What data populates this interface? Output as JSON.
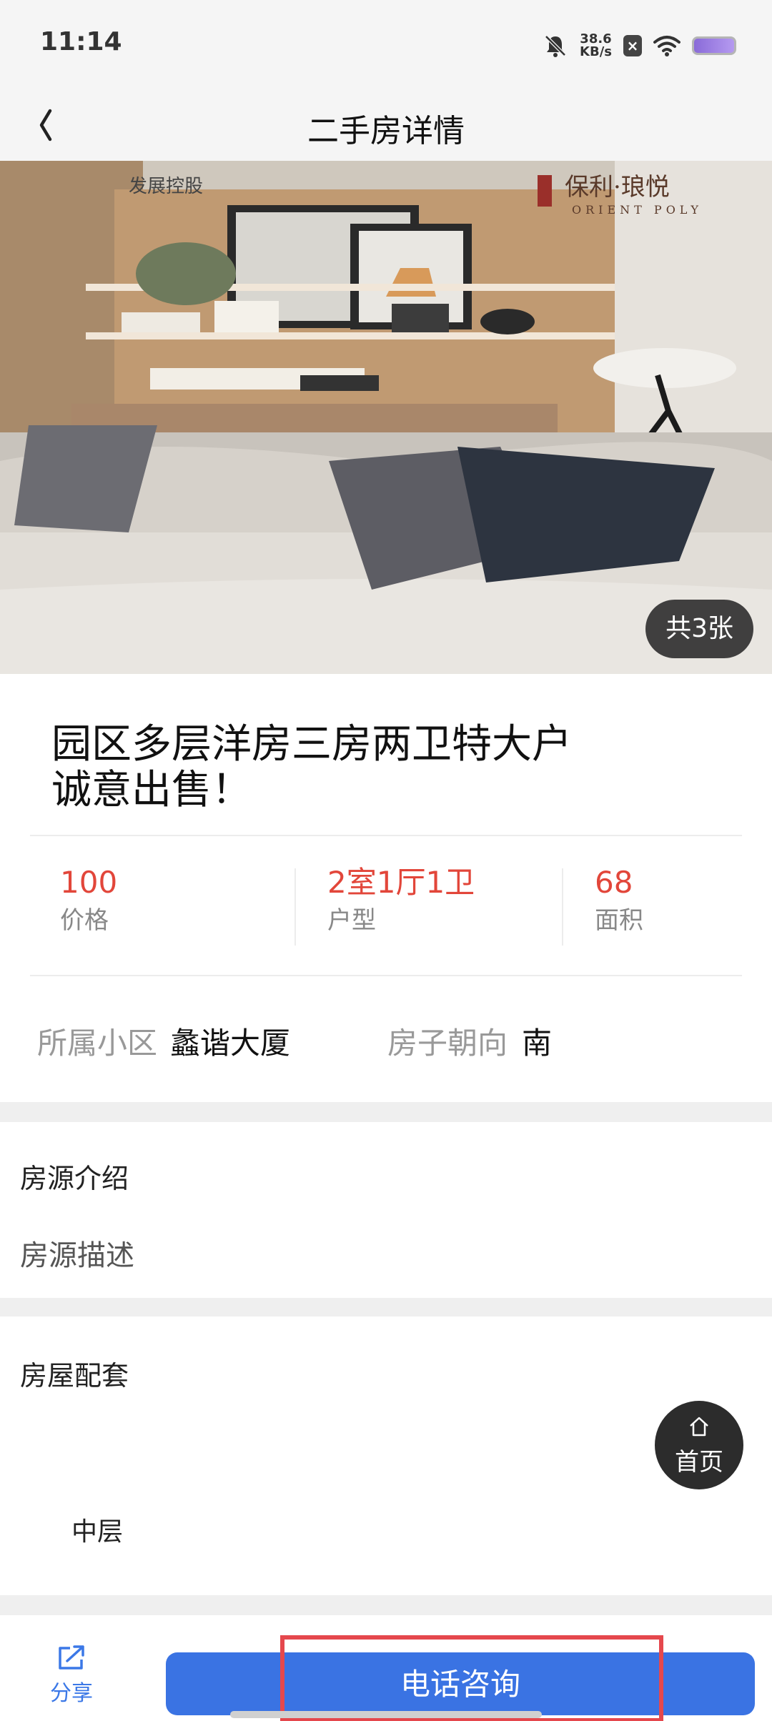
{
  "status_bar": {
    "time": "11:14",
    "net_speed_value": "38.6",
    "net_speed_unit": "KB/s",
    "icons": [
      "bell-muted-icon",
      "close-box-icon",
      "wifi-icon",
      "battery-icon"
    ]
  },
  "header": {
    "back_icon": "chevron-left-icon",
    "title": "二手房详情"
  },
  "gallery": {
    "count_label": "共3张",
    "overlay_left_text": "发展控股",
    "overlay_brand_cn": "保利·琅悦",
    "overlay_brand_en": "ORIENT POLY"
  },
  "listing": {
    "title_line1": "园区多层洋房三房两卫特大户",
    "title_line2": "诚意出售！"
  },
  "stats": [
    {
      "value": "100",
      "label": "价格"
    },
    {
      "value": "2室1厅1卫",
      "label": "户型"
    },
    {
      "value": "68",
      "label": "面积"
    }
  ],
  "info": {
    "community_label": "所属小区",
    "community_value": "蠡谐大厦",
    "orientation_label": "房子朝向",
    "orientation_value": "南"
  },
  "intro": {
    "heading": "房源介绍",
    "description_label": "房源描述"
  },
  "amenities": {
    "heading": "房屋配套",
    "items": [
      "中层"
    ]
  },
  "fab": {
    "icon": "home-icon",
    "label": "首页"
  },
  "bottom_bar": {
    "share_icon": "share-icon",
    "share_label": "分享",
    "call_label": "电话咨询"
  },
  "colors": {
    "accent_red": "#e2463a",
    "primary_blue": "#3a73e3",
    "highlight_red": "#e5484d"
  }
}
